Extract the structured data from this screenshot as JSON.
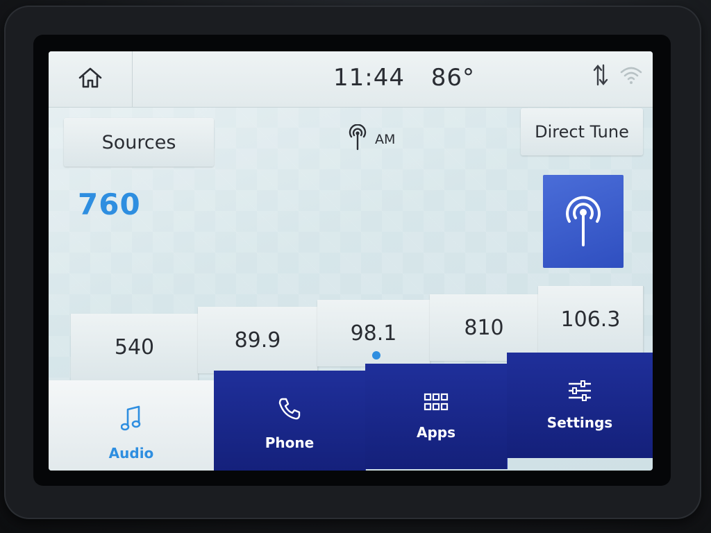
{
  "status_bar": {
    "time": "11:44",
    "temperature": "86°"
  },
  "audio": {
    "sources_label": "Sources",
    "band": "AM",
    "direct_tune_label": "Direct Tune",
    "frequency": "760"
  },
  "presets": [
    "540",
    "89.9",
    "98.1",
    "810",
    "106.3"
  ],
  "nav": {
    "audio": "Audio",
    "phone": "Phone",
    "apps": "Apps",
    "settings": "Settings"
  },
  "colors": {
    "accent": "#2e8ee0",
    "nav_blue": "#1a2788",
    "station_art": "#3a5bcc"
  }
}
